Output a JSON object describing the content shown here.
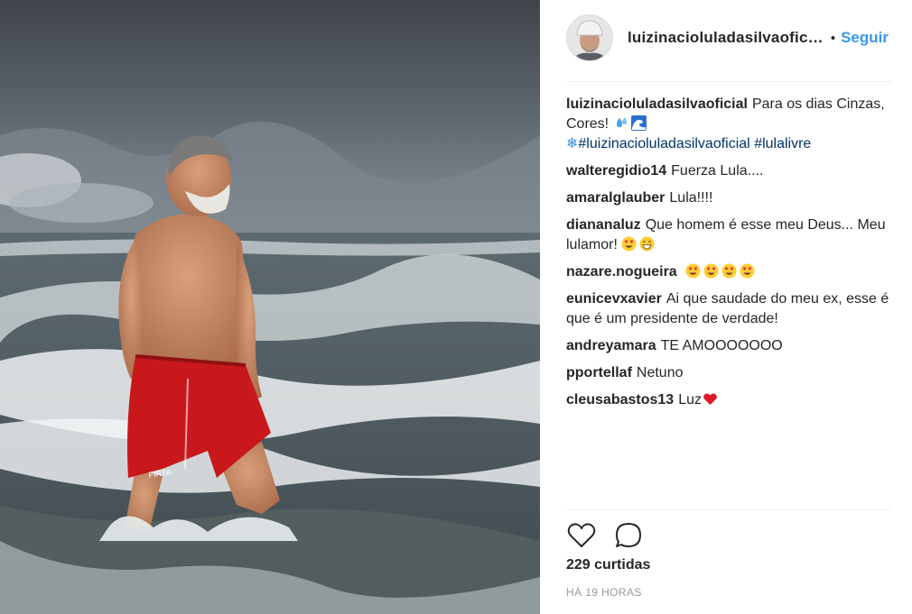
{
  "post": {
    "owner_username": "luizinacioluladasilvaoficial",
    "owner_username_display": "luizinacioluladasilvaofic…",
    "separator": "•",
    "follow_label": "Seguir",
    "caption": {
      "username": "luizinacioluladasilvaoficial",
      "text": "Para os dias Cinzas, Cores!",
      "emojis": [
        "droplets-emoji",
        "wave-emoji"
      ],
      "snowflake": "❄",
      "hashtags": [
        "#luizinacioluladasilvaoficial",
        "#lulalivre"
      ]
    },
    "comments": [
      {
        "user": "walteregidio14",
        "text": "Fuerza Lula...."
      },
      {
        "user": "amaralglauber",
        "text": "Lula!!!!"
      },
      {
        "user": "diananaluz",
        "text": "Que homem é esse meu Deus... Meu lulamor!",
        "emojis": [
          "heart-eyes-emoji",
          "grinning-emoji"
        ]
      },
      {
        "user": "nazare.nogueira",
        "text": "",
        "emojis": [
          "heart-eyes-emoji",
          "heart-eyes-emoji",
          "heart-eyes-emoji",
          "heart-eyes-emoji"
        ]
      },
      {
        "user": "eunicevxavier",
        "text": "Ai que saudade do meu ex, esse é que é um presidente de verdade!"
      },
      {
        "user": "andreyamara",
        "text": "TE AMOOOOOOO"
      },
      {
        "user": "pportellaf",
        "text": "Netuno"
      },
      {
        "user": "cleusabastos13",
        "text": "Luz",
        "emojis": [
          "red-heart-emoji"
        ]
      }
    ],
    "likes_label": "229 curtidas",
    "timestamp": "HÁ 19 HORAS",
    "icons": {
      "like": "heart-outline-icon",
      "comment": "speech-bubble-icon"
    },
    "colors": {
      "link": "#3897f0",
      "hashtag": "#003569",
      "text": "#262626",
      "muted": "#999999",
      "shorts": "#c8181c"
    }
  }
}
